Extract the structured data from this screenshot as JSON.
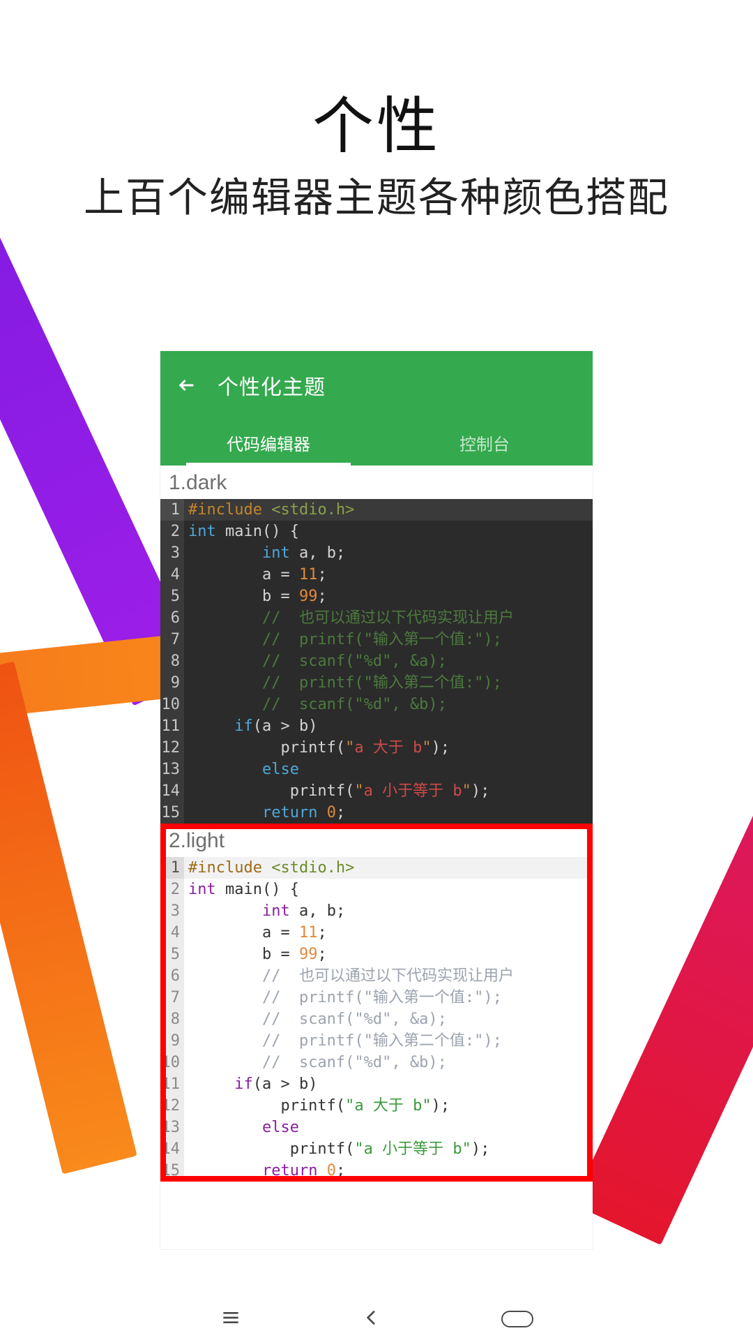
{
  "marketing": {
    "headline": "个性",
    "subheadline": "上百个编辑器主题各种颜色搭配"
  },
  "appbar": {
    "title": "个性化主题",
    "tabs": [
      {
        "label": "代码编辑器",
        "active": true
      },
      {
        "label": "控制台",
        "active": false
      }
    ]
  },
  "themes": [
    {
      "index": 1,
      "name": "dark",
      "title": "1.dark",
      "selected": false
    },
    {
      "index": 2,
      "name": "light",
      "title": "2.light",
      "selected": true
    }
  ],
  "code_sample": {
    "lines": [
      {
        "n": 1,
        "cur": true,
        "tokens": [
          [
            "ppkw",
            "#include"
          ],
          [
            "pp",
            " <stdio.h>"
          ]
        ]
      },
      {
        "n": 2,
        "tokens": [
          [
            "ty",
            "int"
          ],
          [
            "",
            " main() {"
          ]
        ]
      },
      {
        "n": 3,
        "tokens": [
          [
            "",
            "        "
          ],
          [
            "ty",
            "int"
          ],
          [
            "",
            " a, b;"
          ]
        ]
      },
      {
        "n": 4,
        "tokens": [
          [
            "",
            "        a = "
          ],
          [
            "num",
            "11"
          ],
          [
            "",
            ";"
          ]
        ]
      },
      {
        "n": 5,
        "tokens": [
          [
            "",
            "        b = "
          ],
          [
            "num",
            "99"
          ],
          [
            "",
            ";"
          ]
        ]
      },
      {
        "n": 6,
        "tokens": [
          [
            "",
            "        "
          ],
          [
            "cm",
            "//  也可以通过以下代码实现让用户"
          ]
        ]
      },
      {
        "n": 7,
        "tokens": [
          [
            "",
            "        "
          ],
          [
            "cm",
            "//  printf(\"输入第一个值:\");"
          ]
        ]
      },
      {
        "n": 8,
        "tokens": [
          [
            "",
            "        "
          ],
          [
            "cm",
            "//  scanf(\"%d\", &a);"
          ]
        ]
      },
      {
        "n": 9,
        "tokens": [
          [
            "",
            "        "
          ],
          [
            "cm",
            "//  printf(\"输入第二个值:\");"
          ]
        ]
      },
      {
        "n": 10,
        "tokens": [
          [
            "",
            "        "
          ],
          [
            "cm",
            "//  scanf(\"%d\", &b);"
          ]
        ]
      },
      {
        "n": 11,
        "tokens": [
          [
            "",
            "     "
          ],
          [
            "kw",
            "if"
          ],
          [
            "",
            "(a > b)"
          ]
        ]
      },
      {
        "n": 12,
        "tokens": [
          [
            "",
            "          printf("
          ],
          [
            "str",
            "\""
          ],
          [
            "str-zh",
            "a 大于 b"
          ],
          [
            "str",
            "\""
          ],
          [
            "",
            ");"
          ]
        ]
      },
      {
        "n": 13,
        "tokens": [
          [
            "",
            "        "
          ],
          [
            "kw",
            "else"
          ]
        ]
      },
      {
        "n": 14,
        "tokens": [
          [
            "",
            "           printf("
          ],
          [
            "str",
            "\""
          ],
          [
            "str-zh",
            "a 小于等于 b"
          ],
          [
            "str",
            "\""
          ],
          [
            "",
            ");"
          ]
        ]
      },
      {
        "n": 15,
        "tokens": [
          [
            "",
            "        "
          ],
          [
            "kw",
            "return"
          ],
          [
            "",
            " "
          ],
          [
            "num",
            "0"
          ],
          [
            "",
            ";"
          ]
        ]
      }
    ]
  }
}
